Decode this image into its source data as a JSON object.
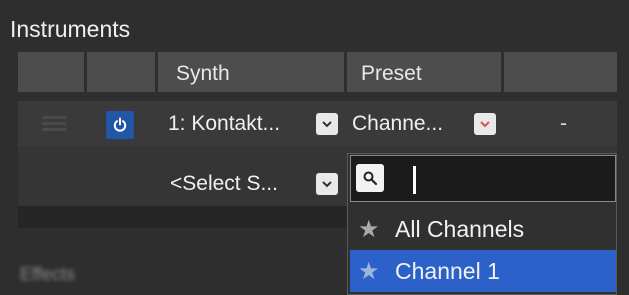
{
  "panel": {
    "title": "Instruments",
    "section2_title": "Effects"
  },
  "columns": {
    "synth": "Synth",
    "preset": "Preset"
  },
  "row1": {
    "synth_value": "1: Kontakt...",
    "preset_value": "Channe...",
    "extra_value": "-"
  },
  "row2": {
    "synth_placeholder": "<Select S..."
  },
  "dropdown": {
    "search_value": "",
    "options": [
      {
        "label": "All Channels",
        "selected": false
      },
      {
        "label": "Channel 1",
        "selected": true
      }
    ]
  },
  "colors": {
    "accent": "#2257a7",
    "selection": "#2b61c8",
    "preset_chevron": "#d9534f"
  },
  "icons": [
    "grip-icon",
    "power-icon",
    "chevron-down-icon",
    "search-icon",
    "star-icon"
  ]
}
